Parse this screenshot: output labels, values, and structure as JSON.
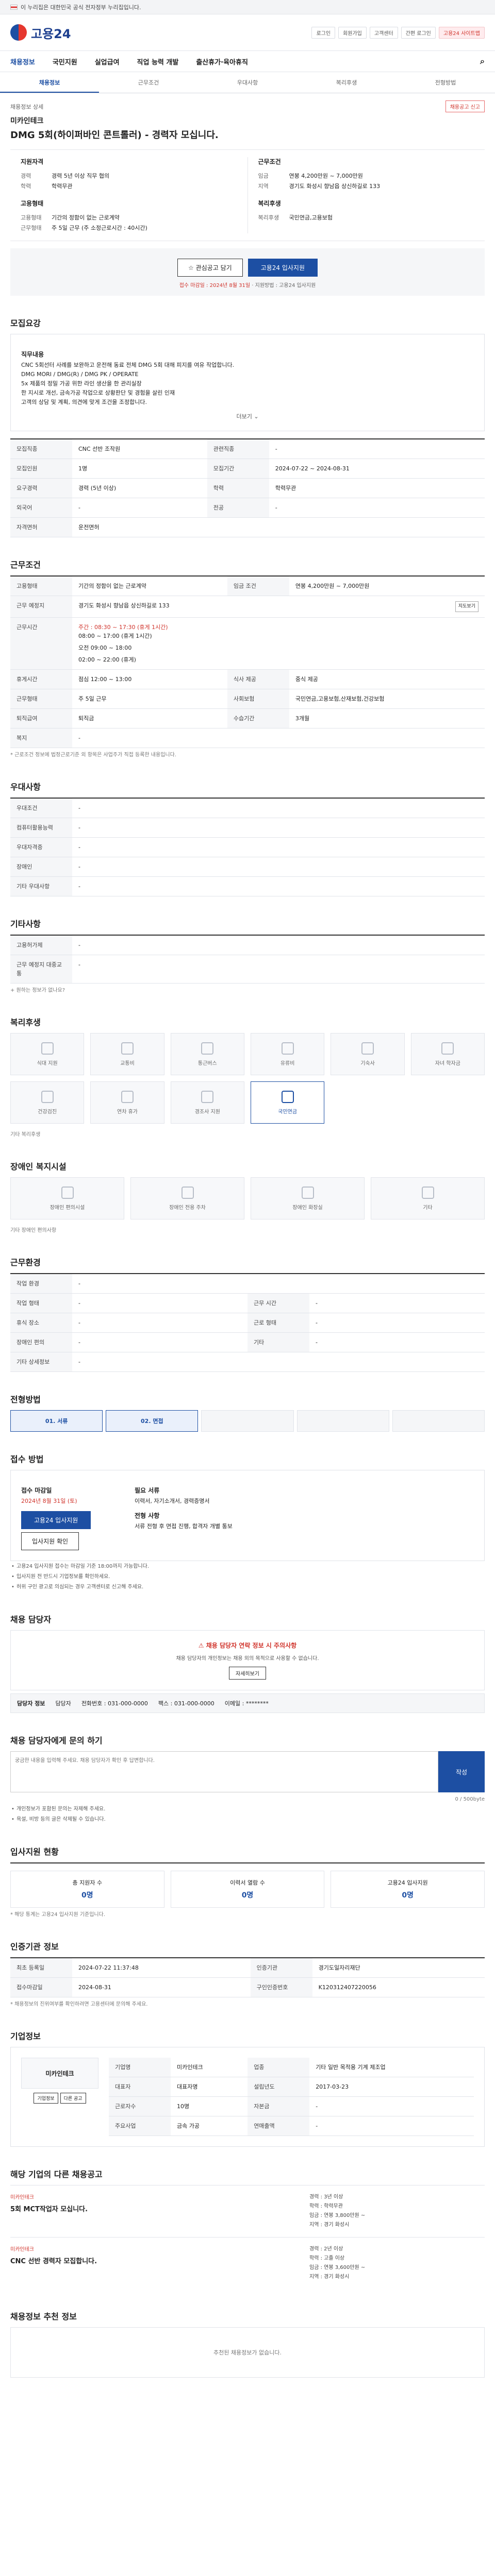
{
  "top": {
    "notice": "이 누리집은 대한민국 공식 전자정부 누리집입니다."
  },
  "logo": {
    "text": "고용24"
  },
  "util": [
    "로그인",
    "회원가입",
    "고객센터",
    "간편 로그인",
    "고용24 사이트맵"
  ],
  "gnb": [
    "채용정보",
    "국민지원",
    "실업급여",
    "직업 능력 개발",
    "출산휴가·육아휴직"
  ],
  "tabs": [
    "채용정보",
    "근무조건",
    "우대사항",
    "복리후생",
    "전형방법"
  ],
  "crumb": {
    "path": "채용정보 상세",
    "report": "채용공고 신고"
  },
  "job": {
    "company": "미카인테크",
    "title": "DMG 5회(하이퍼바인 콘트롤러) - 경력자 모십니다."
  },
  "summary": {
    "left_h": "지원자격",
    "left": [
      [
        "경력",
        "경력 5년 이상 직무 협의"
      ],
      [
        "학력",
        "학력무관"
      ]
    ],
    "right_h": "근무조건",
    "right": [
      [
        "임금",
        "연봉 4,200만원 ~ 7,000만원"
      ],
      [
        "지역",
        "경기도 화성시 향남읍 상신하길로 133"
      ]
    ],
    "l2h": "고용형태",
    "l2": [
      [
        "고용형태",
        "기간의 정함이 없는 근로계약"
      ],
      [
        "근무형태",
        "주 5일 근무 (주 소정근로시간 : 40시간)"
      ]
    ],
    "r2h": "복리후생",
    "r2": [
      [
        "복리후생",
        "국민연금,고용보험"
      ]
    ]
  },
  "actions": {
    "scrap": "관심공고 담기",
    "apply": "고용24 입사지원",
    "fine_a": "접수 마감일 : 2024년 8월 31일",
    "fine_b": "지원방법 : 고용24 입사지원"
  },
  "sec_job": {
    "h": "모집요강",
    "sub": "직무내용",
    "lines": [
      "CNC 5회선터 사례를 보완하고 운전해 동료 전체 DMG 5회 대해 피지를 여유 작업합니다.",
      "DMG MORI / DMG(R) / DMG PK / OPERATE",
      "5x 제품의 정밀 가공 위한 라인 생산을 한 관리실장",
      "한 지시로 개선, 금속가공 작업으로 상황판단 및 경험을 살린 인재",
      "고객의 상담 및 계획, 의견에 맞게 조건을 조정합니다."
    ],
    "more": "더보기"
  },
  "sec_job_table": [
    [
      "모집직종",
      "CNC 선반 조작원",
      "관련직종",
      "-"
    ],
    [
      "모집인원",
      "1명",
      "모집기간",
      "2024-07-22 ~ 2024-08-31"
    ],
    [
      "요구경력",
      "경력 (5년 이상)",
      "학력",
      "학력무관"
    ],
    [
      "외국어",
      "-",
      "전공",
      "-"
    ],
    [
      "자격면허",
      "운전면허",
      "",
      ""
    ]
  ],
  "sec_work": {
    "h": "근무조건",
    "rows": [
      [
        "고용형태",
        "기간의 정함이 없는 근로계약",
        "임금 조건",
        "연봉 4,200만원 ~ 7,000만원"
      ]
    ],
    "addr_label": "근무 예정지",
    "addr": "경기도 화성시 향남읍 상신하길로 133",
    "time_label": "근무시간",
    "time": "주간 : 08:30 ~ 17:30 (휴게 1시간)",
    "time2": "08:00 ~ 17:00 (휴게 1시간)",
    "time3": "오전 09:00 ~ 18:00",
    "time4": "02:00 ~ 22:00 (휴게)",
    "extra": [
      [
        "휴게시간",
        "점심 12:00 ~ 13:00",
        "식사 제공",
        "중식 제공"
      ],
      [
        "근무형태",
        "주 5일 근무",
        "사회보험",
        "국민연금,고용보험,산재보험,건강보험"
      ],
      [
        "퇴직급여",
        "퇴직금",
        "수습기간",
        "3개월"
      ],
      [
        "복지",
        "-",
        "",
        ""
      ]
    ],
    "note": "* 근로조건 정보에 법정근로기준 외 항목은 사업주가 직접 등록한 내용입니다."
  },
  "sec_pref": {
    "h": "우대사항",
    "rows": [
      [
        "우대조건",
        "-"
      ],
      [
        "컴퓨터활용능력",
        "-"
      ],
      [
        "우대자격증",
        "-"
      ],
      [
        "장애인",
        "-"
      ],
      [
        "기타 우대사항",
        "-"
      ]
    ]
  },
  "sec_env": {
    "h": "기타사항",
    "rows": [
      [
        "고용허가제",
        "-"
      ],
      [
        "근무 예정지 대중교통",
        "-"
      ]
    ],
    "more": "+ 원하는 정보가 없나요?"
  },
  "sec_welfare": {
    "h": "복리후생",
    "items": [
      "식대 지원",
      "교통비",
      "통근버스",
      "유류비",
      "기숙사",
      "자녀 학자금",
      "건강검진",
      "연차 휴가",
      "경조사 지원",
      "국민연금",
      "",
      "",
      ""
    ],
    "active": "국민연금",
    "more": "기타 복리후생"
  },
  "sec_disab": {
    "h": "장애인 복지시설",
    "items": [
      "장애인 편의시설",
      "장애인 전용 주차",
      "장애인 화장실",
      "기타"
    ],
    "more": "기타 장애인 편의사항"
  },
  "sec_proc": {
    "h": "근무환경",
    "rows": [
      [
        "작업 환경",
        "-",
        "",
        ""
      ],
      [
        "작업 형태",
        "-",
        "근무 시간",
        "-"
      ],
      [
        "휴식 장소",
        "-",
        "근로 형태",
        "-"
      ],
      [
        "장애인 편의",
        "-",
        "기타",
        "-"
      ],
      [
        "기타 상세정보",
        "-",
        "",
        ""
      ]
    ]
  },
  "sec_select": {
    "h": "전형방법",
    "steps": [
      "서류",
      "면접",
      "",
      "",
      "",
      ""
    ]
  },
  "sec_apply": {
    "h": "접수 방법",
    "left_label": "접수 마감일",
    "deadline": "2024년 8월 31일 (토)",
    "apply_btn": "고용24 입사지원",
    "home_btn": "입사지원 확인",
    "right_label": "필요 서류",
    "docs": "이력서, 자기소개서, 경력증명서",
    "memo_label": "전형 사항",
    "memo": "서류 전형 후 면접 진행, 합격자 개별 통보",
    "notes": [
      "고용24 입사지원 접수는 마감일 기준 18:00까지 가능합니다.",
      "입사지원 전 반드시 기업정보를 확인하세요.",
      "허위 구인 광고로 의심되는 경우 고객센터로 신고해 주세요."
    ]
  },
  "sec_contact": {
    "h": "채용 담당자",
    "warn": "채용 담당자 연락 정보 시 주의사항",
    "warn_text": "채용 담당자의 개인정보는 채용 외의 목적으로 사용할 수 없습니다.",
    "warn_link": "자세히보기",
    "name_label": "담당자 정보",
    "name": "담당자",
    "phone": "전화번호 : 031-000-0000",
    "fax": "팩스 : 031-000-0000",
    "email": "이메일 : ********"
  },
  "sec_qna": {
    "h": "채용 담당자에게 문의 하기",
    "placeholder": "궁금한 내용을 입력해 주세요. 채용 담당자가 확인 후 답변합니다.",
    "submit": "작성",
    "count": "0 / 500byte",
    "notes": [
      "개인정보가 포함된 문의는 자제해 주세요.",
      "욕설, 비방 등의 글은 삭제될 수 있습니다."
    ]
  },
  "sec_stats": {
    "h": "입사지원 현황",
    "items": [
      [
        "총 지원자 수",
        "0명"
      ],
      [
        "이력서 열람 수",
        "0명"
      ],
      [
        "고용24 입사지원",
        "0명"
      ]
    ],
    "note": "* 해당 통계는 고용24 입사지원 기준입니다."
  },
  "sec_info": {
    "h": "인증기관 정보",
    "rows": [
      [
        "최초 등록일",
        "2024-07-22 11:37:48",
        "인증기관",
        "경기도일자리재단"
      ],
      [
        "접수마감일",
        "2024-08-31",
        "구인인증번호",
        "K120312407220056"
      ]
    ],
    "note": "* 채용정보의 진위여부를 확인하려면 고용센터에 문의해 주세요."
  },
  "sec_company": {
    "h": "기업정보",
    "name": "미카인테크",
    "rows": [
      [
        "기업명",
        "미카인테크",
        "업종",
        "기타 일반 목적용 기계 제조업"
      ],
      [
        "대표자",
        "대표자명",
        "설립년도",
        "2017-03-23"
      ],
      [
        "근로자수",
        "10명",
        "자본금",
        "-"
      ],
      [
        "주요사업",
        "금속 가공",
        "연매출액",
        "-"
      ]
    ],
    "btns": [
      "기업정보",
      "다른 공고"
    ]
  },
  "sec_rec": {
    "h": "해당 기업의 다른 채용공고",
    "items": [
      {
        "company": "미카인테크",
        "title": "5회 MCT작업자 모십니다.",
        "info": [
          "경력 : 3년 이상",
          "학력 : 학력무관",
          "임금 : 연봉 3,800만원 ~",
          "지역 : 경기 화성시"
        ]
      },
      {
        "company": "미카인테크",
        "title": "CNC 선반 경력자 모집합니다.",
        "info": [
          "경력 : 2년 이상",
          "학력 : 고졸 이상",
          "임금 : 연봉 3,600만원 ~",
          "지역 : 경기 화성시"
        ]
      }
    ]
  },
  "sec_similar": {
    "h": "채용정보 추천 정보",
    "empty": "추천된 채용정보가 없습니다."
  }
}
